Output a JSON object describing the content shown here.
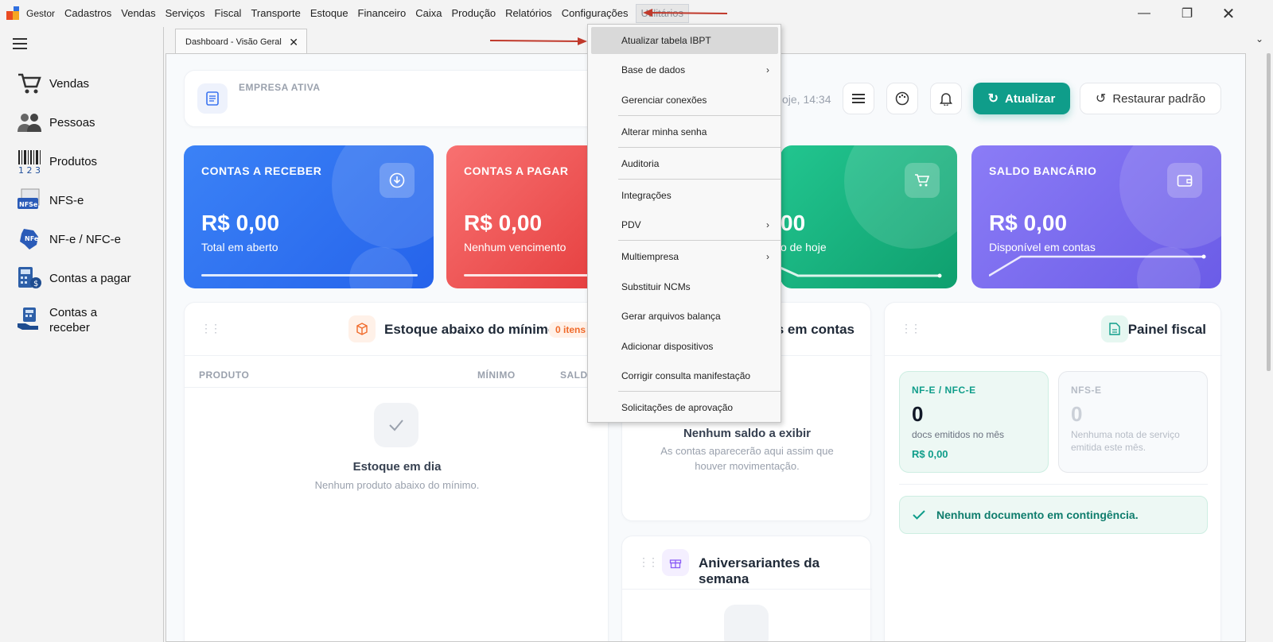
{
  "menubar": {
    "items": [
      "Gestor",
      "Cadastros",
      "Vendas",
      "Serviços",
      "Fiscal",
      "Transporte",
      "Estoque",
      "Financeiro",
      "Caixa",
      "Produção",
      "Relatórios",
      "Configurações",
      "Utilitários"
    ]
  },
  "sidebar": {
    "items": [
      {
        "label": "Vendas"
      },
      {
        "label": "Pessoas"
      },
      {
        "label": "Produtos"
      },
      {
        "label": "NFS-e"
      },
      {
        "label": "NF-e / NFC-e"
      },
      {
        "label": "Contas a pagar"
      },
      {
        "label": "Contas a\nreceber"
      }
    ]
  },
  "tab": {
    "label": "Dashboard - Visão Geral"
  },
  "header": {
    "empresa_label": "EMPRESA ATIVA",
    "timestamp": "oje, 14:34",
    "refresh_label": "Atualizar",
    "restore_label": "Restaurar padrão"
  },
  "kpis": [
    {
      "label": "CONTAS A RECEBER",
      "value": "R$ 0,00",
      "sub": "Total em aberto",
      "color": "#3b74f0"
    },
    {
      "label": "CONTAS A PAGAR",
      "value": "R$ 0,00",
      "sub": "Nenhum vencimento",
      "color": "#ef4d4d"
    },
    {
      "label": "",
      "value": "00",
      "sub": "o de hoje",
      "color": "#17b07e"
    },
    {
      "label": "SALDO BANCÁRIO",
      "value": "R$ 0,00",
      "sub": "Disponível em contas",
      "color": "#7a6cf0"
    }
  ],
  "estoque": {
    "title": "Estoque abaixo do mínimo",
    "badge": "0 itens",
    "col_produto": "PRODUTO",
    "col_minimo": "MÍNIMO",
    "col_saldo": "SALDO",
    "empty_title": "Estoque em dia",
    "empty_sub": "Nenhum produto abaixo do mínimo."
  },
  "saldos": {
    "title": "os em contas",
    "empty_title": "Nenhum saldo a exibir",
    "empty_sub1": "As contas aparecerão aqui assim que",
    "empty_sub2": "houver movimentação."
  },
  "aniversariantes": {
    "title": "Aniversariantes da semana"
  },
  "fiscal": {
    "title": "Painel fiscal",
    "nfe_label": "NF-E / NFC-E",
    "nfe_value": "0",
    "nfe_sub": "docs emitidos no mês",
    "nfe_amount": "R$ 0,00",
    "nfse_label": "NFS-E",
    "nfse_value": "0",
    "nfse_sub1": "Nenhuma nota de serviço",
    "nfse_sub2": "emitida este mês.",
    "contingencia": "Nenhum documento em contingência."
  },
  "dropdown": {
    "items": [
      {
        "label": "Atualizar tabela IBPT"
      },
      {
        "label": "Base de dados",
        "submenu": true
      },
      {
        "label": "Gerenciar conexões"
      },
      {
        "label": "Alterar minha senha"
      },
      {
        "label": "Auditoria"
      },
      {
        "label": "Integrações"
      },
      {
        "label": "PDV",
        "submenu": true
      },
      {
        "label": "Multiempresa",
        "submenu": true
      },
      {
        "label": "Substituir NCMs"
      },
      {
        "label": "Gerar arquivos balança"
      },
      {
        "label": "Adicionar dispositivos"
      },
      {
        "label": "Corrigir consulta manifestação"
      },
      {
        "label": "Solicitações de aprovação"
      }
    ]
  }
}
